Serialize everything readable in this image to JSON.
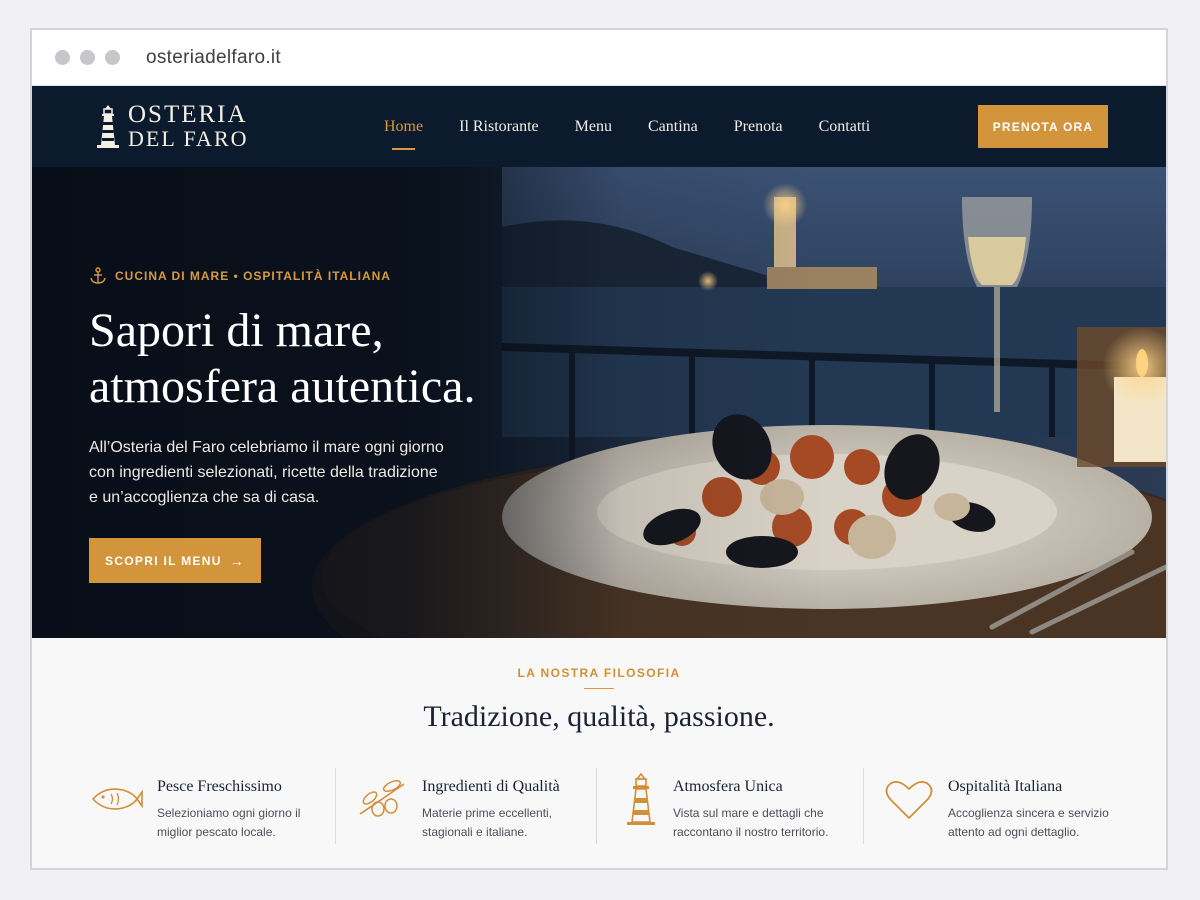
{
  "browser": {
    "url": "osteriadelfaro.it"
  },
  "brand": {
    "line1": "OSTERIA",
    "line2": "DEL FARO"
  },
  "nav": {
    "items": [
      {
        "label": "Home"
      },
      {
        "label": "Il Ristorante"
      },
      {
        "label": "Menu"
      },
      {
        "label": "Cantina"
      },
      {
        "label": "Prenota"
      },
      {
        "label": "Contatti"
      }
    ],
    "active": "Home",
    "cta": "PRENOTA ORA"
  },
  "hero": {
    "eyebrow": "CUCINA DI MARE • OSPITALITÀ ITALIANA",
    "headline": "Sapori di mare,\natmosfera autentica.",
    "text": "All’Osteria del Faro celebriamo il mare ogni giorno\ncon ingredienti selezionati, ricette della tradizione\ne un’accoglienza che sa di casa.",
    "cta": "SCOPRI IL MENU",
    "cta_arrow": "→"
  },
  "philosophy": {
    "eyebrow": "LA NOSTRA FILOSOFIA",
    "title": "Tradizione, qualità, passione.",
    "features": [
      {
        "icon": "fish-icon",
        "title": "Pesce Freschissimo",
        "desc": "Selezioniamo ogni giorno il\nmiglior pescato locale."
      },
      {
        "icon": "olive-icon",
        "title": "Ingredienti di Qualità",
        "desc": "Materie prime eccellenti,\nstagionali e italiane."
      },
      {
        "icon": "lighthouse-icon",
        "title": "Atmosfera Unica",
        "desc": "Vista sul mare e dettagli che\nraccontano il nostro territorio."
      },
      {
        "icon": "heart-icon",
        "title": "Ospitalità Italiana",
        "desc": "Accoglienza sincera e servizio\nattento ad ogni dettaglio."
      }
    ]
  },
  "colors": {
    "navy": "#0c1a2e",
    "accent": "#d3953b",
    "background": "#f8f8f9",
    "text_dark": "#1a2233"
  }
}
